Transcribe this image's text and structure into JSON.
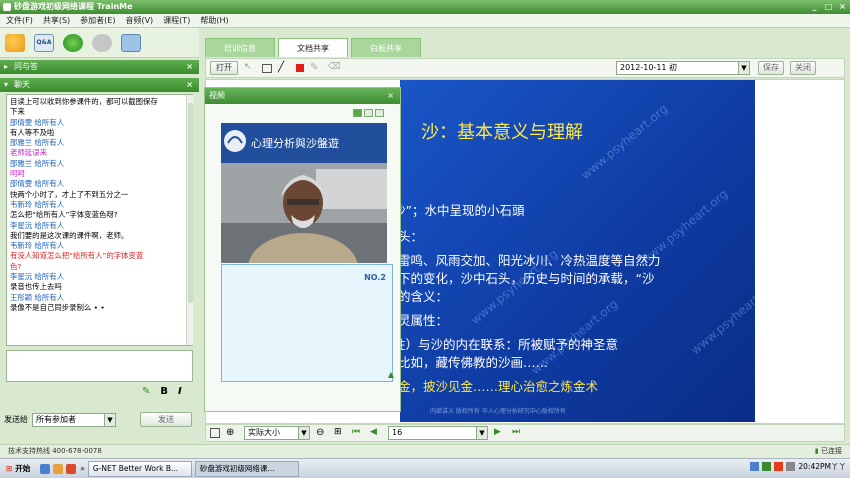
{
  "window": {
    "title": "砂盘游戏初级网络课程 TrainMe",
    "controls": [
      "_",
      "□",
      "×"
    ]
  },
  "menu": [
    "文件(F)",
    "共享(S)",
    "参加者(E)",
    "音频(V)",
    "课程(T)",
    "帮助(H)"
  ],
  "left_tools": [
    {
      "icon": "users-icon",
      "label": ""
    },
    {
      "icon": "qa-icon",
      "label": "Q&A"
    },
    {
      "icon": "globe-icon",
      "label": ""
    },
    {
      "icon": "disk-icon",
      "label": ""
    },
    {
      "icon": "screen-icon",
      "label": ""
    }
  ],
  "panels": {
    "participants": "问与答",
    "chat": "聊天"
  },
  "chat": [
    {
      "t": "目读上可以收到你参课件的，都可以截图保存",
      "c": "#000"
    },
    {
      "t": "下来",
      "c": "#000"
    },
    {
      "t": "邵倩雯  给所有人",
      "c": "#1a5fbf"
    },
    {
      "t": "有人等不及啦",
      "c": "#000"
    },
    {
      "t": "邵雅兰  给所有人",
      "c": "#1a5fbf"
    },
    {
      "t": "老师延误来",
      "c": "#d020d0"
    },
    {
      "t": "邵雅兰  给所有人",
      "c": "#1a5fbf"
    },
    {
      "t": "呵呵",
      "c": "#d020d0"
    },
    {
      "t": "邵倩雯  给所有人",
      "c": "#1a5fbf"
    },
    {
      "t": "快两个小时了，才上了不到五分之一",
      "c": "#000"
    },
    {
      "t": "韦新玲  给所有人",
      "c": "#1a5fbf"
    },
    {
      "t": "怎么把“给所有人”字体变蓝色呀?",
      "c": "#000"
    },
    {
      "t": "李星沅  给所有人",
      "c": "#1a5fbf"
    },
    {
      "t": "我们要的是这次课的课件啊，老师。",
      "c": "#000"
    },
    {
      "t": "韦新玲  给所有人",
      "c": "#1a5fbf"
    },
    {
      "t": "有没人知道怎么把“给所有人”的字体变蓝",
      "c": "#e02020"
    },
    {
      "t": "色?",
      "c": "#e02020"
    },
    {
      "t": "李星沅  给所有人",
      "c": "#1a5fbf"
    },
    {
      "t": "录音也传上去吗",
      "c": "#000"
    },
    {
      "t": "王彤颖  给所有人",
      "c": "#1a5fbf"
    },
    {
      "t": "录像不是自己同步录制么 • •",
      "c": "#000"
    }
  ],
  "composer": {
    "bold": "B",
    "italic": "I"
  },
  "send": {
    "label": "发送给",
    "target": "所有参加者",
    "button": "发送"
  },
  "status": {
    "hotline": "技术支持热线 400-678-0078",
    "connection": "已连接"
  },
  "tabs": [
    {
      "label": "培训信息",
      "active": false
    },
    {
      "label": "文档共享",
      "active": true
    },
    {
      "label": "白板共享",
      "active": false
    }
  ],
  "toolbar": {
    "open": "打开",
    "date": "2012-10-11 初",
    "save": "保存",
    "close": "关闭"
  },
  "video": {
    "title": "视频",
    "banner": "心理分析與沙盤遊",
    "slot2_label": "NO.2"
  },
  "slide": {
    "title": "沙：基本意义与理解",
    "lines": [
      {
        "t": "）：",
        "c": "w"
      },
      {
        "t": "少為沙”；水中呈现的小石頭",
        "c": "w"
      },
      {
        "t": "头：",
        "c": "w"
      },
      {
        "t": "雷鸣、风雨交加、阳光冰川、冷热温度等自然力",
        "c": "w"
      },
      {
        "t": "下的变化，沙中石头，历史与时间的承载，“沙",
        "c": "w"
      },
      {
        "t": "的含义：",
        "c": "w"
      },
      {
        "t": "灵属性：",
        "c": "w"
      },
      {
        "t": "（自性）与沙的内在联系：所被赋予的神圣意",
        "c": "w"
      },
      {
        "t": "比如，藏传佛教的沙画……",
        "c": "w"
      },
      {
        "t": "金，披沙见金……理心治愈之炼金术",
        "c": "y"
      }
    ],
    "watermark": "www.psyheart.org",
    "footer": "内部讲义   版权所有   华人心理分析研究中心版权所有"
  },
  "nav": {
    "zoom": "实际大小",
    "page": "16"
  },
  "taskbar": {
    "start": "开始",
    "items": [
      "G-NET Better Work B...",
      "砂盘游戏初级网络课..."
    ],
    "time": "20:42PM丫丫"
  }
}
